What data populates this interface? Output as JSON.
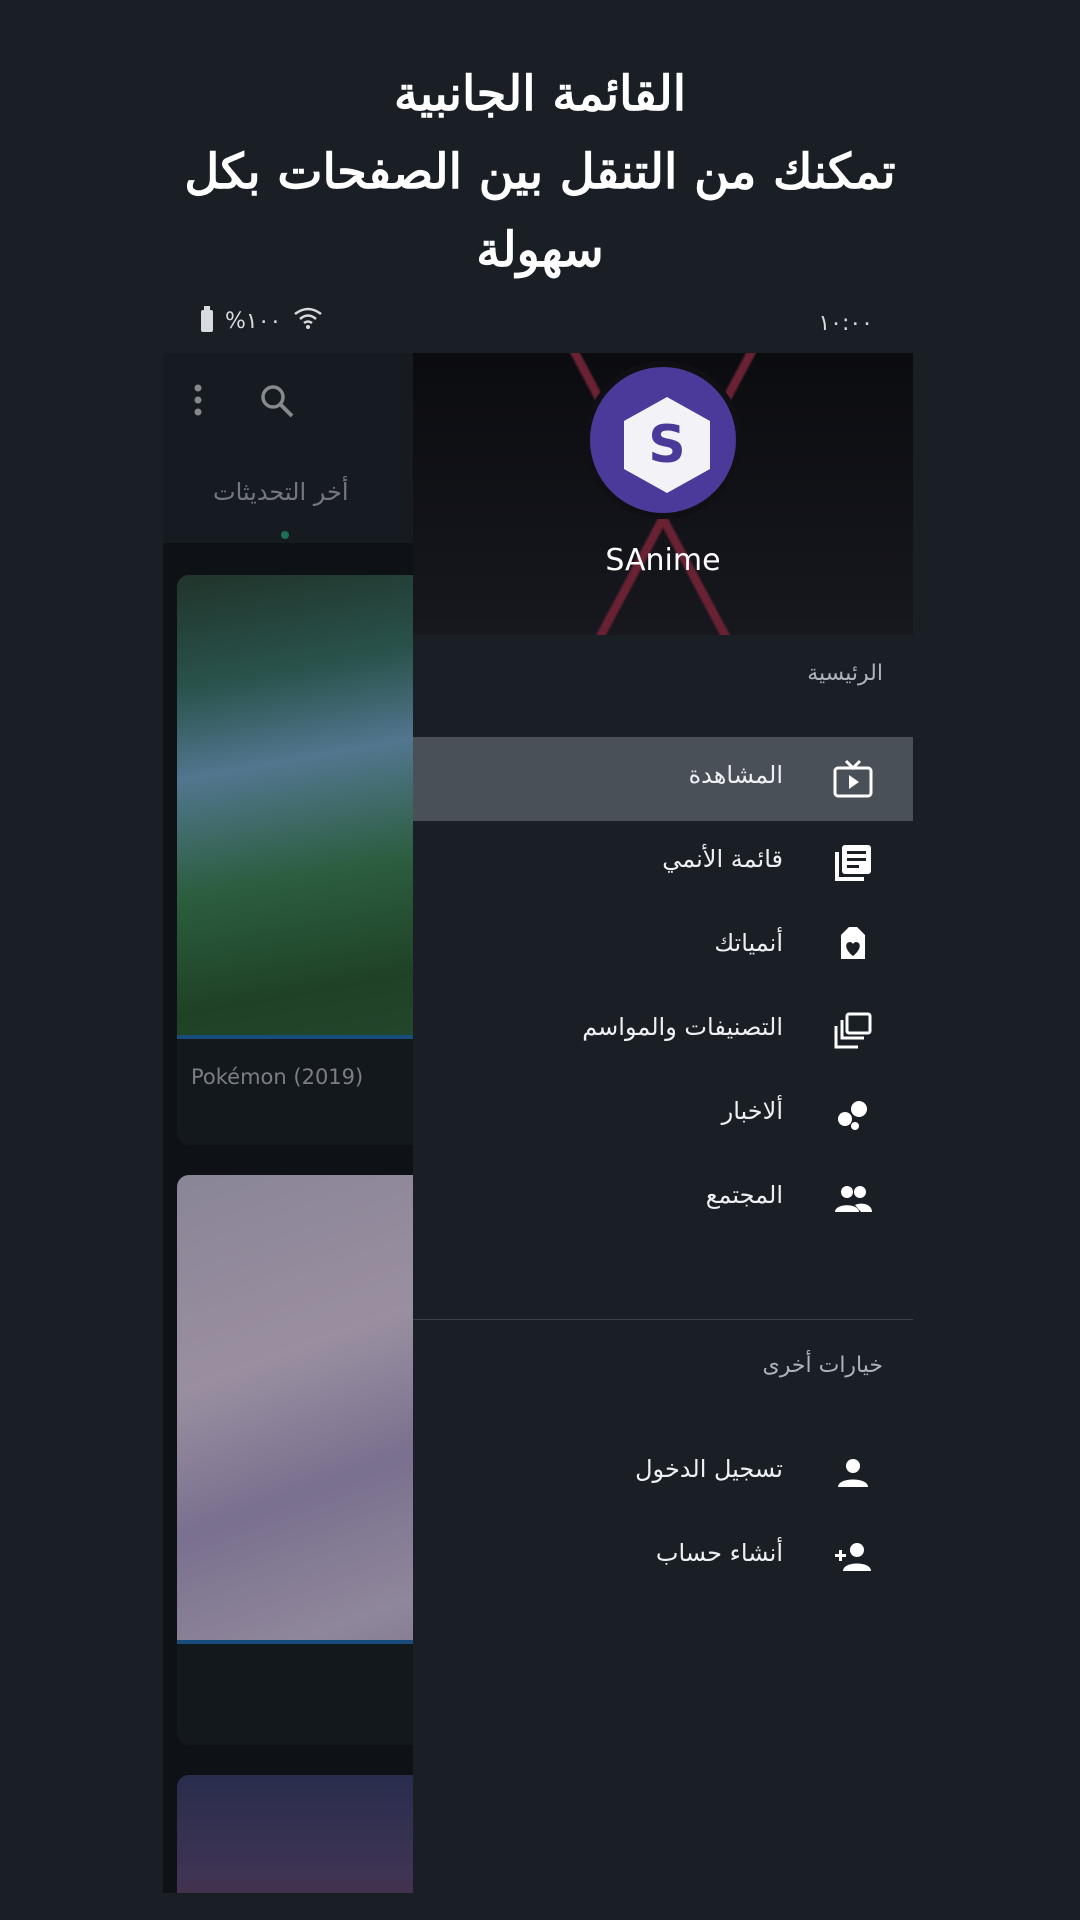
{
  "promo": {
    "line1": "القائمة الجانبية",
    "line2": "تمكنك من التنقل بين الصفحات بكل",
    "line3": "سهولة"
  },
  "status_bar": {
    "time": "١٠:٠٠",
    "battery": "%١٠٠"
  },
  "background_app": {
    "tab_label": "أخر التحديثات",
    "cards": [
      {
        "title": "Pokémon (2019)"
      },
      {
        "title": ""
      },
      {
        "title": ""
      }
    ]
  },
  "drawer": {
    "app_name": "SAnime",
    "logo_letter": "S",
    "main_section": "الرئيسية",
    "items": [
      {
        "label": "المشاهدة",
        "icon": "tv-play-icon",
        "active": true
      },
      {
        "label": "قائمة الأنمي",
        "icon": "list-icon",
        "active": false
      },
      {
        "label": "أنمياتك",
        "icon": "heart-tag-icon",
        "active": false
      },
      {
        "label": "التصنيفات والمواسم",
        "icon": "collections-icon",
        "active": false
      },
      {
        "label": "ألاخبار",
        "icon": "bubbles-icon",
        "active": false
      },
      {
        "label": "المجتمع",
        "icon": "people-icon",
        "active": false
      }
    ],
    "other_section": "خيارات أخرى",
    "other_items": [
      {
        "label": "تسجيل الدخول",
        "icon": "person-icon"
      },
      {
        "label": "أنشاء حساب",
        "icon": "person-add-icon"
      }
    ]
  },
  "colors": {
    "background": "#1a1f26",
    "active_item": "#4a5058",
    "logo": "#4b3a9a",
    "tab_indicator": "#27a37a"
  }
}
